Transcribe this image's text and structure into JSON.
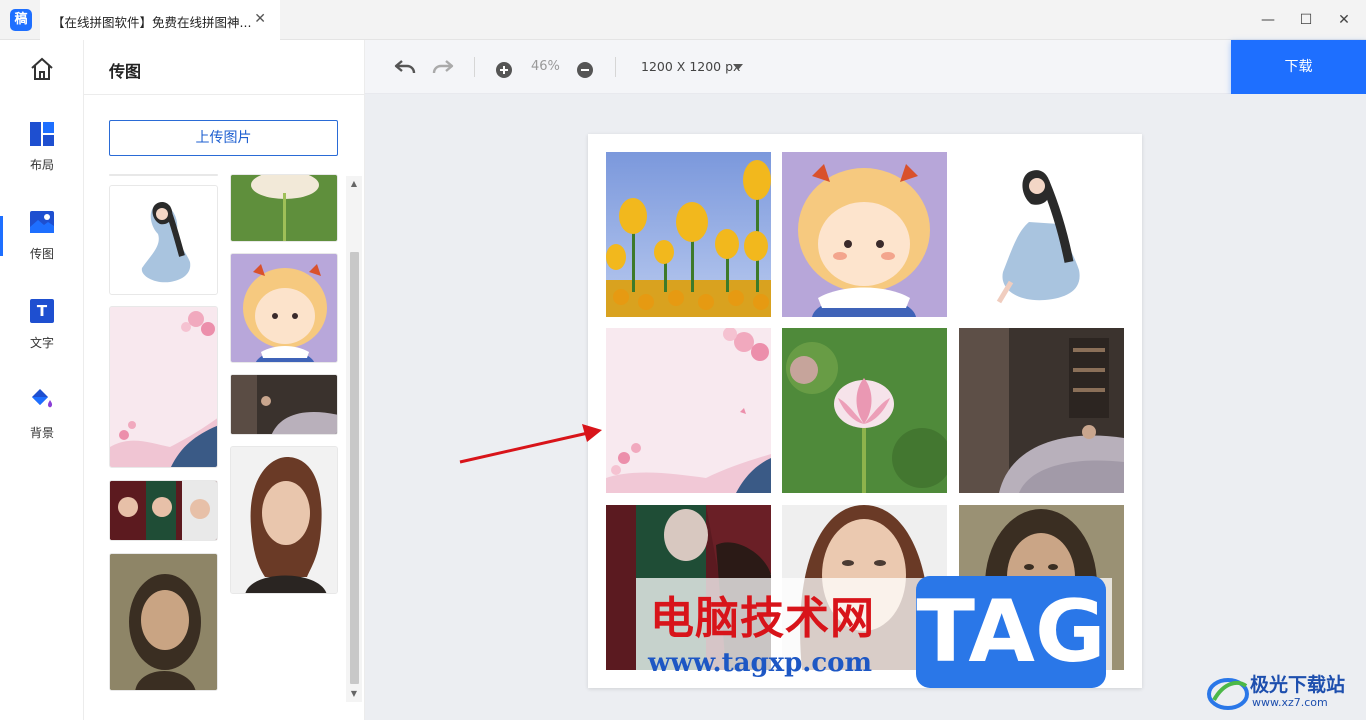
{
  "window": {
    "app_icon": "稿",
    "tab_title": "【在线拼图软件】免费在线拼图神...",
    "tab_close": "✕",
    "minimize": "—",
    "maximize": "☐",
    "close": "✕"
  },
  "rail": {
    "items": [
      {
        "label": ""
      },
      {
        "label": "布局"
      },
      {
        "label": "传图"
      },
      {
        "label": "文字"
      },
      {
        "label": "背景"
      }
    ],
    "active": "传图",
    "text_icon_letter": "T"
  },
  "panel": {
    "title": "传图",
    "upload_label": "上传图片"
  },
  "toolbar": {
    "zoom": "46%",
    "canvas_size": "1200 X 1200 px",
    "download_label": "下载"
  },
  "watermark": {
    "title": "电脑技术网",
    "url": "www.tagxp.com",
    "tag": "TAG",
    "site": "极光下载站",
    "site_url": "www.xz7.com"
  },
  "colors": {
    "accent": "#1e6fff",
    "canvas": "#eceef2"
  }
}
